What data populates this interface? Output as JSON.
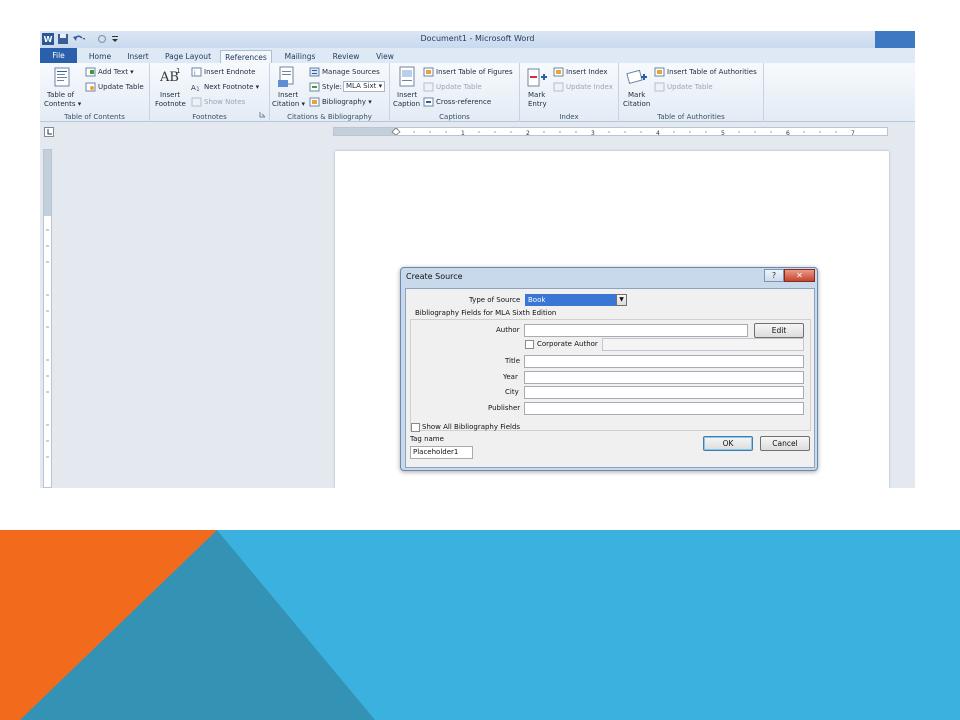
{
  "window": {
    "title": "Document1 - Microsoft Word"
  },
  "tabs": [
    "File",
    "Home",
    "Insert",
    "Page Layout",
    "References",
    "Mailings",
    "Review",
    "View"
  ],
  "ribbon": {
    "toc": {
      "button": [
        "Table of",
        "Contents ▾"
      ],
      "add_text": "Add Text ▾",
      "update_table": "Update Table",
      "label": "Table of Contents"
    },
    "footnotes": {
      "insert_footnote": [
        "Insert",
        "Footnote"
      ],
      "insert_endnote": "Insert Endnote",
      "next_footnote": "Next Footnote ▾",
      "show_notes": "Show Notes",
      "label": "Footnotes"
    },
    "citations": {
      "insert_citation": [
        "Insert",
        "Citation ▾"
      ],
      "manage_sources": "Manage Sources",
      "style_label": "Style:",
      "style_value": "MLA Sixt",
      "bibliography": "Bibliography ▾",
      "label": "Citations & Bibliography"
    },
    "captions": {
      "insert_caption": [
        "Insert",
        "Caption"
      ],
      "insert_tof": "Insert Table of Figures",
      "update_table": "Update Table",
      "cross_reference": "Cross-reference",
      "label": "Captions"
    },
    "index": {
      "mark_entry": [
        "Mark",
        "Entry"
      ],
      "insert_index": "Insert Index",
      "update_index": "Update Index",
      "label": "Index"
    },
    "toa": {
      "mark_citation": [
        "Mark",
        "Citation"
      ],
      "insert_toa": "Insert Table of Authorities",
      "update_table": "Update Table",
      "label": "Table of Authorities"
    }
  },
  "ruler_ticks": [
    "1",
    "2",
    "3",
    "4",
    "5",
    "6",
    "7"
  ],
  "dialog": {
    "title": "Create Source",
    "help": "?",
    "close": "✕",
    "type_label": "Type of Source",
    "type_value": "Book",
    "fields_heading": "Bibliography Fields for MLA Sixth Edition",
    "author_label": "Author",
    "edit_button": "Edit",
    "corporate_label": "Corporate Author",
    "title_label": "Title",
    "year_label": "Year",
    "city_label": "City",
    "publisher_label": "Publisher",
    "show_all_label": "Show All Bibliography Fields",
    "tag_label": "Tag name",
    "tag_value": "Placeholder1",
    "ok_button": "OK",
    "cancel_button": "Cancel"
  },
  "colors": {
    "orange": "#f26b1d",
    "blue_light": "#3ab1de",
    "blue_dark": "#3493b5",
    "file_tab": "#2a5fac"
  }
}
